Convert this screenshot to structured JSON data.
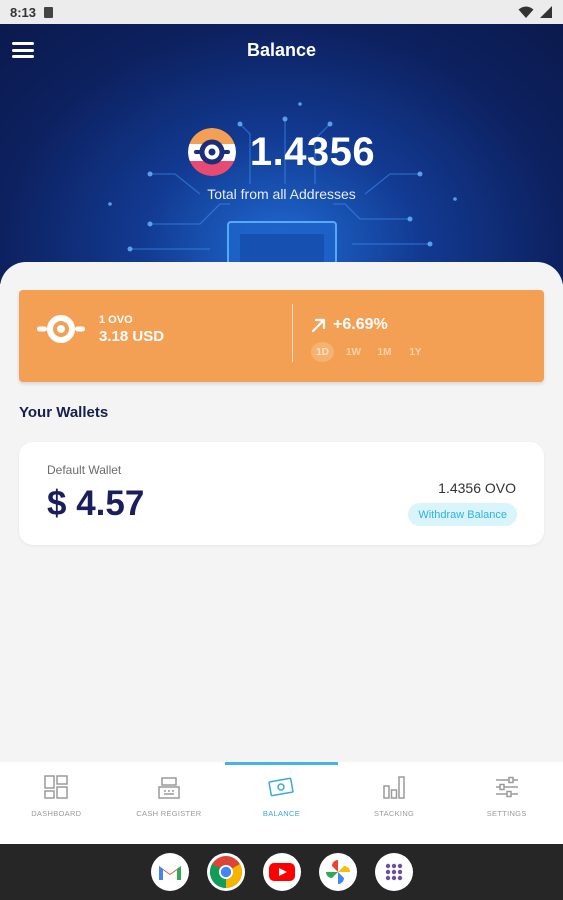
{
  "status_bar": {
    "time": "8:13",
    "icons": [
      "sim-card-icon",
      "wifi-icon",
      "signal-icon"
    ]
  },
  "header": {
    "title": "Balance",
    "menu_icon": "hamburger-menu-icon"
  },
  "balance": {
    "amount": "1.4356",
    "subtitle": "Total from all Addresses",
    "coin_icon": "ovo-coin-icon"
  },
  "price_card": {
    "unit": "1 OVO",
    "usd": "3.18 USD",
    "change": "+6.69%",
    "change_icon": "trend-up-arrow-icon",
    "ranges": [
      "1D",
      "1W",
      "1M",
      "1Y"
    ],
    "active_range": "1D",
    "color": "#f4a054"
  },
  "wallets": {
    "title": "Your Wallets",
    "items": [
      {
        "name": "Default Wallet",
        "usd": "$ 4.57",
        "ovo": "1.4356 OVO",
        "action": "Withdraw Balance"
      }
    ]
  },
  "bottom_nav": {
    "items": [
      {
        "label": "DASHBOARD",
        "icon": "dashboard-icon"
      },
      {
        "label": "CASH REGISTER",
        "icon": "cash-register-icon"
      },
      {
        "label": "BALANCE",
        "icon": "balance-icon"
      },
      {
        "label": "STACKING",
        "icon": "stacking-chart-icon"
      },
      {
        "label": "SETTINGS",
        "icon": "settings-sliders-icon"
      }
    ],
    "active": "BALANCE",
    "accent": "#47b3e2"
  },
  "dock": {
    "apps": [
      "gmail-icon",
      "chrome-icon",
      "youtube-icon",
      "photos-icon",
      "app-drawer-icon"
    ]
  }
}
